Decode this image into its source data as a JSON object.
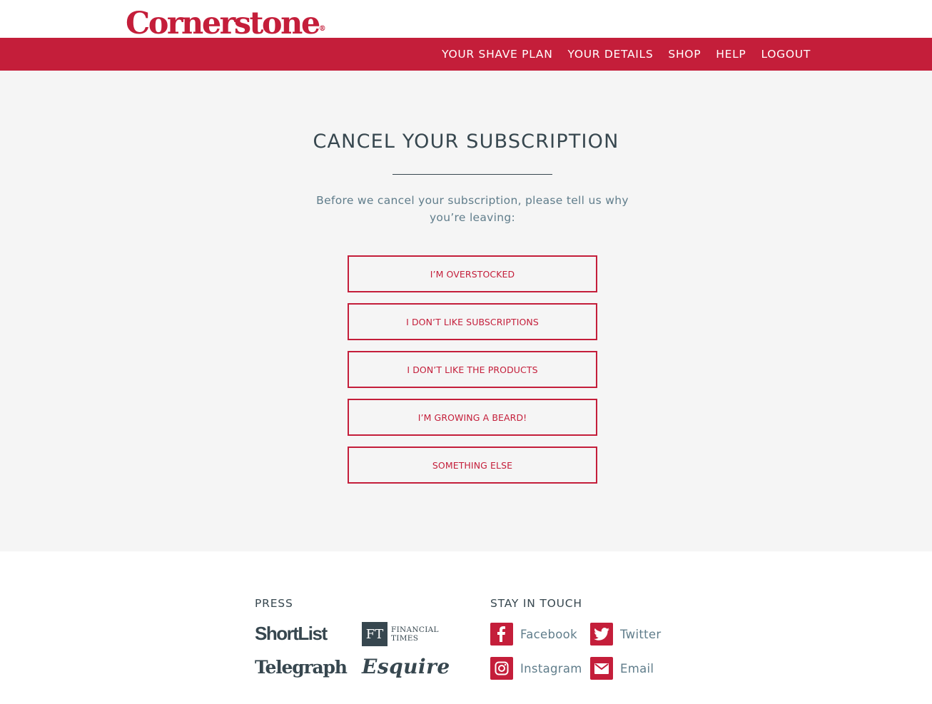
{
  "brand": {
    "name": "Cornerstone",
    "reg_mark": "®",
    "color": "#c41e3a"
  },
  "nav": {
    "items": [
      {
        "label": "YOUR SHAVE PLAN"
      },
      {
        "label": "YOUR DETAILS"
      },
      {
        "label": "SHOP"
      },
      {
        "label": "HELP"
      },
      {
        "label": "LOGOUT"
      }
    ]
  },
  "main": {
    "title": "CANCEL YOUR SUBSCRIPTION",
    "intro": "Before we cancel your subscription, please tell us why you’re leaving:",
    "reasons": [
      {
        "label": "I’M OVERSTOCKED"
      },
      {
        "label": "I DON’T LIKE SUBSCRIPTIONS"
      },
      {
        "label": "I DON’T LIKE THE PRODUCTS"
      },
      {
        "label": "I’M GROWING A BEARD!"
      },
      {
        "label": "SOMETHING ELSE"
      }
    ]
  },
  "footer": {
    "press": {
      "heading": "PRESS",
      "logos": {
        "shortlist": "ShortList",
        "ft_mark": "FT",
        "ft_line1": "FINANCIAL",
        "ft_line2": "TIMES",
        "telegraph": "Telegraph",
        "esquire": "Esquire"
      }
    },
    "social": {
      "heading": "STAY IN TOUCH",
      "links": [
        {
          "label": "Facebook",
          "icon": "facebook-icon"
        },
        {
          "label": "Twitter",
          "icon": "twitter-icon"
        },
        {
          "label": "Instagram",
          "icon": "instagram-icon"
        },
        {
          "label": "Email",
          "icon": "email-icon"
        }
      ]
    }
  }
}
